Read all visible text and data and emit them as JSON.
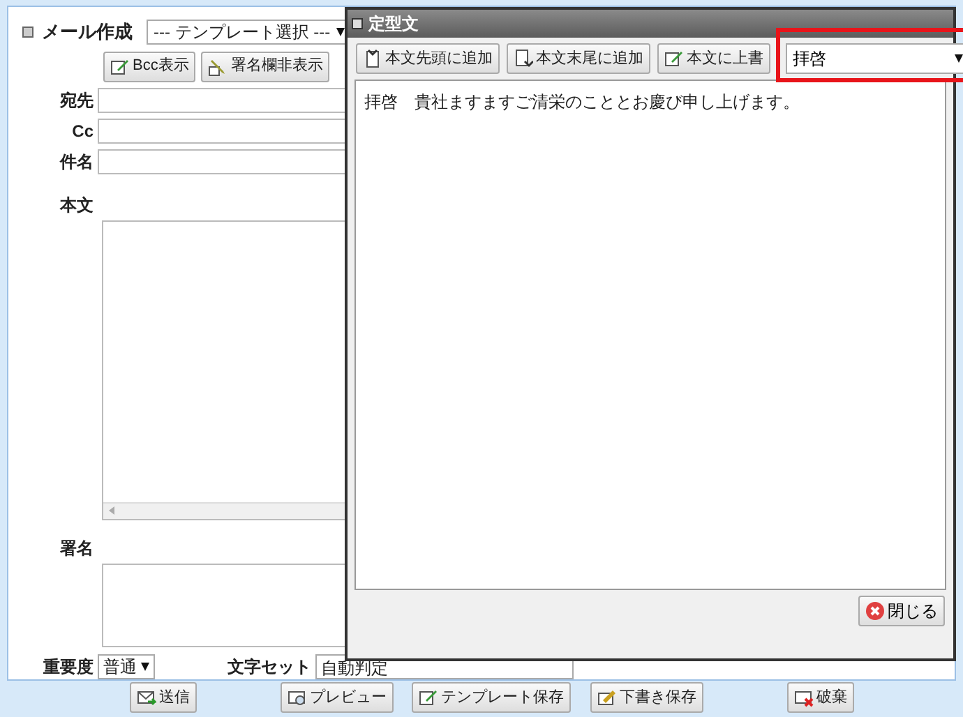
{
  "form": {
    "title": "メール作成",
    "template_select": "--- テンプレート選択 ---",
    "toggle_buttons": [
      {
        "label": "Bcc表示"
      },
      {
        "label": "署名欄非表示"
      }
    ],
    "fields": [
      {
        "label": "宛先"
      },
      {
        "label": "Cc"
      },
      {
        "label": "件名"
      }
    ],
    "body_label": "本文",
    "signature_label": "署名",
    "priority_label": "重要度",
    "priority": "普通",
    "charset_label": "文字セット",
    "charset": "自動判定"
  },
  "actions": [
    {
      "label": "送信"
    },
    {
      "label": "プレビュー"
    },
    {
      "label": "テンプレート保存"
    },
    {
      "label": "下書き保存"
    },
    {
      "label": "破棄"
    }
  ],
  "dialog": {
    "title": "定型文",
    "buttons": [
      {
        "label": "本文先頭に追加"
      },
      {
        "label": "本文末尾に追加"
      },
      {
        "label": "本文に上書"
      }
    ],
    "phrase_select": {
      "value": "拝啓",
      "highlighted": true
    },
    "text": "拝啓　貴社ますますご清栄のこととお慶び申し上げます。",
    "close": "閉じる"
  }
}
